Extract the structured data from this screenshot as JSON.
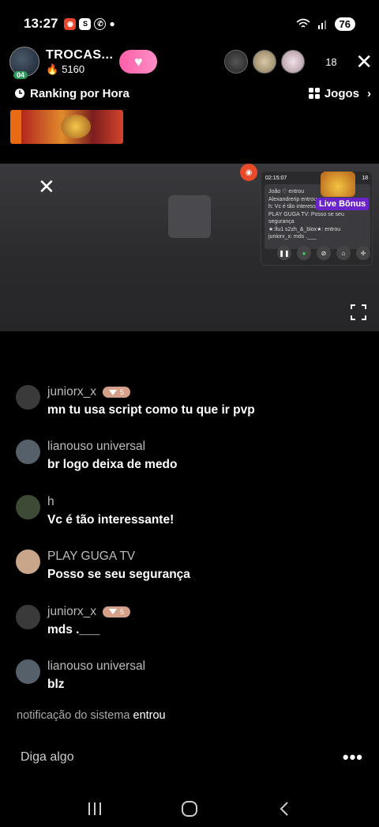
{
  "status": {
    "time": "13:27",
    "battery": "76",
    "app_icons": [
      "cam-icon",
      "s-icon",
      "whatsapp-icon"
    ]
  },
  "host": {
    "name": "TROCAS...",
    "likes": "5160",
    "level": "04",
    "follow_icon": "heart-icon"
  },
  "viewers": {
    "count": "18"
  },
  "ranking": {
    "label": "Ranking por Hora"
  },
  "games": {
    "label": "Jogos"
  },
  "pip": {
    "timer": "02:15:07",
    "viewer_count": "18",
    "live_bonus": "Live Bônus",
    "chat_lines": [
      "João ♡ entrou",
      "Alexandrerip entrou",
      "h: Vc é tão interess",
      "PLAY GUGA TV: Posso se seu",
      "segurança",
      "★:llu1 s2zh_&_blox★: entrou",
      "juniorx_x: mds .___"
    ]
  },
  "chat": [
    {
      "user": "juniorx_x",
      "badge": "5",
      "text": "mn tu usa script como tu que ir pvp",
      "avatar_color": "#3a3a3a"
    },
    {
      "user": "lianouso universal",
      "badge": "",
      "text": "br logo deixa de medo",
      "avatar_color": "#55606a"
    },
    {
      "user": "h",
      "badge": "",
      "text": "Vc é tão interessante!",
      "avatar_color": "#3d4a35"
    },
    {
      "user": "PLAY GUGA TV",
      "badge": "",
      "text": "Posso se seu segurança",
      "avatar_color": "#c9a58a"
    },
    {
      "user": "juniorx_x",
      "badge": "5",
      "text": "mds .___",
      "avatar_color": "#3a3a3a"
    },
    {
      "user": "lianouso universal",
      "badge": "",
      "text": "blz",
      "avatar_color": "#55606a"
    }
  ],
  "system": {
    "label": "notificação do sistema",
    "text": "entrou"
  },
  "input": {
    "placeholder": "Diga algo"
  },
  "colors": {
    "accent_pink": "#ff5fa8",
    "live_bonus_purple": "#6a24c9",
    "badge_color": "#d4a089"
  }
}
